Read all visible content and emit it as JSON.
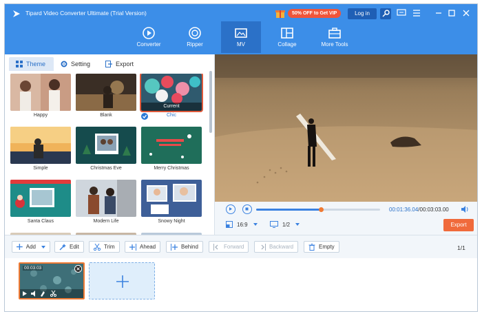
{
  "app": {
    "title": "Tipard Video Converter Ultimate (Trial Version)",
    "promo": "50% OFF to Get VIP",
    "login": "Log in"
  },
  "nav": {
    "items": [
      {
        "label": "Converter",
        "icon": "converter-icon"
      },
      {
        "label": "Ripper",
        "icon": "ripper-icon"
      },
      {
        "label": "MV",
        "icon": "mv-icon"
      },
      {
        "label": "Collage",
        "icon": "collage-icon"
      },
      {
        "label": "More Tools",
        "icon": "toolbox-icon"
      }
    ],
    "active": "MV"
  },
  "tabs": [
    {
      "label": "Theme",
      "icon": "theme-icon"
    },
    {
      "label": "Setting",
      "icon": "gear-icon"
    },
    {
      "label": "Export",
      "icon": "export-icon"
    }
  ],
  "themes": [
    {
      "name": "Happy"
    },
    {
      "name": "Blank"
    },
    {
      "name": "Chic",
      "badge": "Current"
    },
    {
      "name": "Simple"
    },
    {
      "name": "Christmas Eve"
    },
    {
      "name": "Merry Christmas"
    },
    {
      "name": "Santa Claus"
    },
    {
      "name": "Modern Life"
    },
    {
      "name": "Snowy Night"
    }
  ],
  "playback": {
    "current_time": "00:01:36.04",
    "total_time": "/00:03:03.00",
    "progress": 0.52,
    "aspect_ratio": "16:9",
    "screen": "1/2",
    "export_label": "Export"
  },
  "toolbar": {
    "add": "Add",
    "edit": "Edit",
    "trim": "Trim",
    "ahead": "Ahead",
    "behind": "Behind",
    "forward": "Forward",
    "backward": "Backward",
    "empty": "Empty",
    "page_current": "1",
    "page_total": "/1"
  },
  "timeline": {
    "clip_time": "00:03:03"
  },
  "colors": {
    "header": "#3c8ee8",
    "accent": "#3b82e0",
    "export": "#f06a3b"
  }
}
